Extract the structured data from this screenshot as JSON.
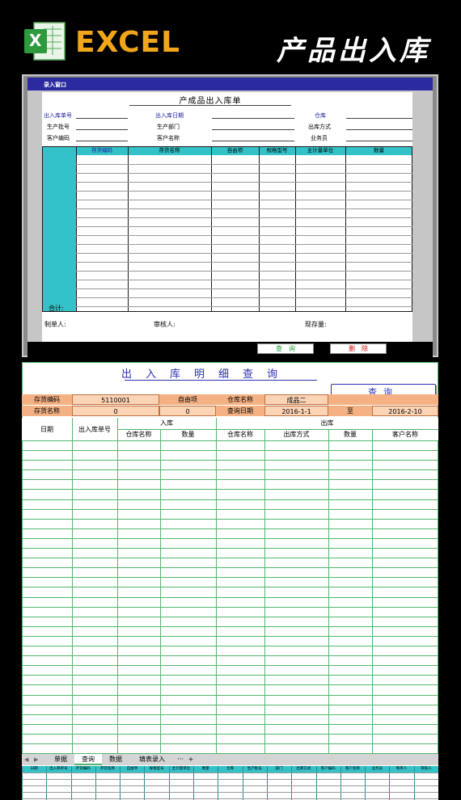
{
  "banner": {
    "logo_letter": "X",
    "app_word": "EXCEL",
    "title": "产品出入库"
  },
  "entry": {
    "window_title": "录入窗口",
    "form_title": "产成品出入库单",
    "fields": {
      "outbound_no": "出入库单号",
      "outbound_date": "出入库日期",
      "warehouse": "仓库",
      "batch_no": "生产批号",
      "dept": "生产部门",
      "out_method": "出库方式",
      "customer_code": "客户编码",
      "customer_name": "客户名称",
      "salesman": "业务员"
    },
    "columns": [
      "存货编码",
      "存货名称",
      "自由项",
      "规格型号",
      "主计量单位",
      "数量"
    ],
    "total_label": "合计:",
    "maker_label": "制单人:",
    "auditor_label": "审核人:",
    "stock_label": "现存量:",
    "query_button": "查　询",
    "delete_button": "删　除"
  },
  "query": {
    "title": "出入库明细查询",
    "query_button": "查询",
    "row1": {
      "code_label": "存货编码",
      "code_value": "5110001",
      "free_label": "自由项",
      "free_value": "",
      "wh_label": "仓库名称",
      "wh_value": "成品二"
    },
    "row2": {
      "name_label": "存货名称",
      "name_value": "0",
      "free_value": "0",
      "date_label": "查询日期",
      "date_from": "2016-1-1",
      "to_label": "至",
      "date_to": "2016-2-10"
    },
    "headers": {
      "date": "日期",
      "doc_no": "出入库单号",
      "in_group": "入库",
      "out_group": "出库",
      "in_wh": "仓库名称",
      "in_qty": "数量",
      "out_wh": "仓库名称",
      "out_method": "出库方式",
      "out_qty": "数量",
      "customer": "客户名称"
    }
  },
  "tabs": {
    "items": [
      "单据",
      "查询",
      "数据",
      "填表录入"
    ],
    "active": "查询",
    "more": "···",
    "add": "+"
  },
  "data_strip": {
    "columns": [
      "日期",
      "出入库单号",
      "存货编码",
      "存货名称",
      "自由项",
      "规格型号",
      "主计量单位",
      "数量",
      "仓库",
      "生产批号",
      "部门",
      "出库方式",
      "客户编码",
      "客户名称",
      "业务员",
      "制单人",
      "审核人"
    ]
  },
  "colors": {
    "banner_bg": "#000000",
    "excel_orange": "#f1a51a",
    "window_title_bar": "#2b2aa0",
    "grid_header_cyan": "#33c2c7",
    "query_title_blue": "#2b2fb0",
    "info_orange": "#f4b183",
    "grid_green": "#53b66e"
  }
}
